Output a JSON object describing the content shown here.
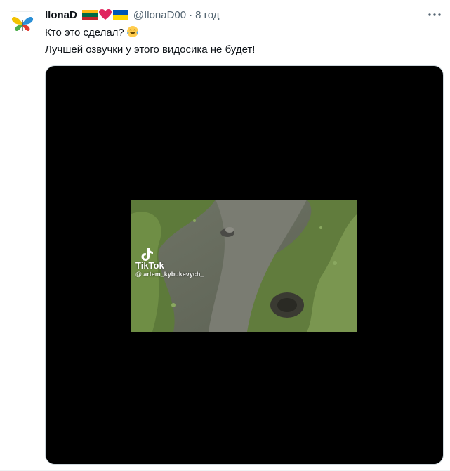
{
  "tweet": {
    "display_name": "IlonaD",
    "handle": "@IlonaD00",
    "separator": "·",
    "timestamp": "8 год",
    "text_line1": "Кто это сделал?",
    "text_line2": "Лучшей озвучки у этого видосика не будет!",
    "more_icon": "more-horizontal-icon"
  },
  "flags": [
    "lithuania-flag",
    "red-heart",
    "ukraine-flag"
  ],
  "media": {
    "type": "video",
    "watermark": {
      "brand": "TikTok",
      "username": "@ artem_kybukevych_"
    }
  },
  "colors": {
    "text": "#0f1419",
    "secondary": "#536471",
    "media_bg": "#000000",
    "heart": "#e0245e"
  }
}
